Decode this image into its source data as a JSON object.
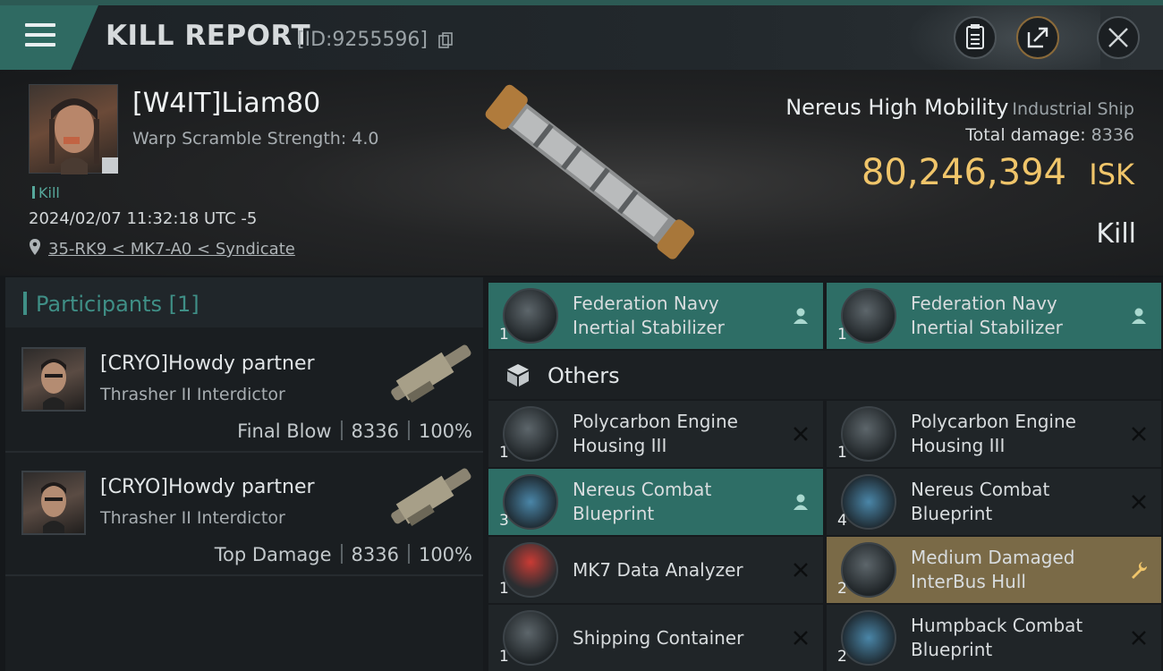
{
  "header": {
    "title": "KILL REPORT",
    "id_label": "[ID:9255596]"
  },
  "victim": {
    "name": "[W4IT]Liam80",
    "warp_scramble": "Warp Scramble Strength: 4.0",
    "tag": "Kill",
    "datetime": "2024/02/07 11:32:18 UTC -5",
    "location": "35-RK9 < MK7-A0 < Syndicate"
  },
  "ship": {
    "name": "Nereus High Mobility",
    "class": "Industrial Ship",
    "total_damage_label": "Total damage:",
    "total_damage": "8336",
    "isk_value": "80,246,394",
    "isk_unit": "ISK",
    "status": "Kill"
  },
  "participants": {
    "title": "Participants [1]",
    "rows": [
      {
        "name": "[CRYO]Howdy partner",
        "ship": "Thrasher II Interdictor",
        "role": "Final Blow",
        "damage": "8336",
        "percent": "100%"
      },
      {
        "name": "[CRYO]Howdy partner",
        "ship": "Thrasher II Interdictor",
        "role": "Top Damage",
        "damage": "8336",
        "percent": "100%"
      }
    ]
  },
  "items": {
    "top": [
      {
        "qty": "1",
        "name_line1": "Federation Navy",
        "name_line2": "Inertial Stabilizer",
        "status": "dropped",
        "status_icon": "person-icon"
      },
      {
        "qty": "1",
        "name_line1": "Federation Navy",
        "name_line2": "Inertial Stabilizer",
        "status": "dropped",
        "status_icon": "person-icon"
      }
    ],
    "others_title": "Others",
    "others": [
      {
        "qty": "1",
        "name_line1": "Polycarbon Engine",
        "name_line2": "Housing III",
        "status": "destroyed",
        "status_icon": "close-icon"
      },
      {
        "qty": "1",
        "name_line1": "Polycarbon Engine",
        "name_line2": "Housing III",
        "status": "destroyed",
        "status_icon": "close-icon"
      },
      {
        "qty": "3",
        "name_line1": "Nereus Combat",
        "name_line2": "Blueprint",
        "status": "dropped",
        "status_icon": "person-icon"
      },
      {
        "qty": "4",
        "name_line1": "Nereus Combat",
        "name_line2": "Blueprint",
        "status": "destroyed",
        "status_icon": "close-icon"
      },
      {
        "qty": "1",
        "name_line1": "MK7 Data Analyzer",
        "name_line2": "",
        "status": "destroyed",
        "status_icon": "close-icon"
      },
      {
        "qty": "2",
        "name_line1": "Medium Damaged",
        "name_line2": "InterBus Hull",
        "status": "fitted",
        "status_icon": "wrench-icon"
      },
      {
        "qty": "1",
        "name_line1": "Shipping Container",
        "name_line2": "",
        "status": "destroyed",
        "status_icon": "close-icon"
      },
      {
        "qty": "2",
        "name_line1": "Humpback Combat",
        "name_line2": "Blueprint",
        "status": "destroyed",
        "status_icon": "close-icon"
      }
    ]
  },
  "colors": {
    "accent_teal": "#2e6e66",
    "isk_gold": "#f0c56a",
    "fitted_gold": "#7a6a47"
  }
}
